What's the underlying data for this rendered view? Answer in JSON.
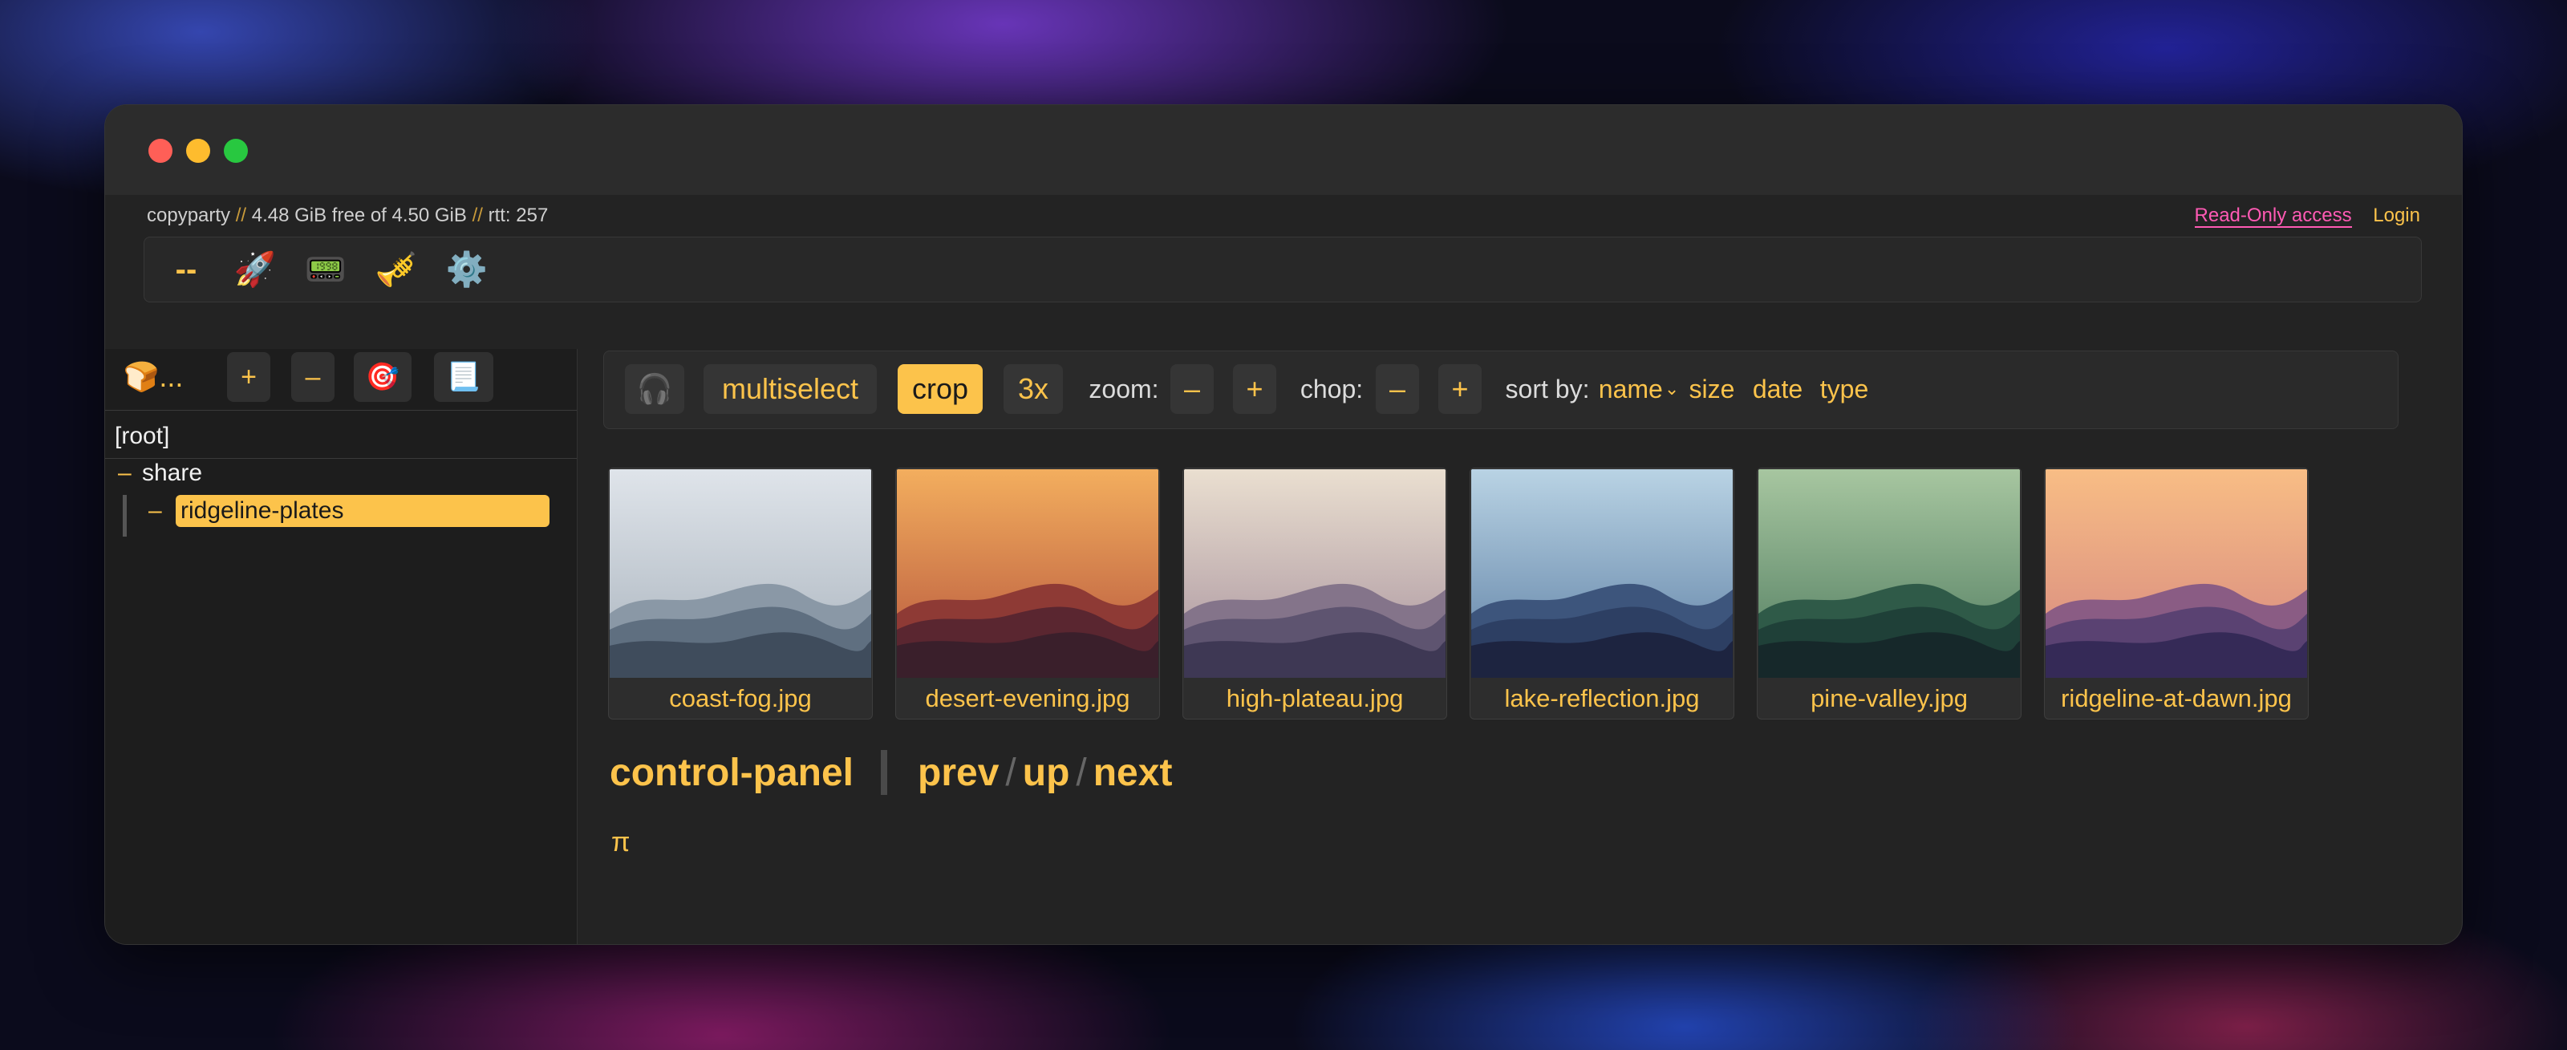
{
  "status": {
    "app": "copyparty",
    "sep": "//",
    "disk": "4.48 GiB free of 4.50 GiB",
    "rtt": "rtt: 257"
  },
  "auth": {
    "readonly": "Read-Only access",
    "login": "Login"
  },
  "opbar": {
    "dash": "--",
    "icons": [
      "rocket-icon",
      "pager-icon",
      "trumpet-icon",
      "gear-icon"
    ],
    "glyphs": [
      "🚀",
      "📟",
      "🎺",
      "⚙️"
    ]
  },
  "sidebar": {
    "bread_label": "🍞...",
    "plus": "+",
    "minus": "–",
    "target": "🎯",
    "scroll": "📃",
    "root": "[root]",
    "tree_minus": "–",
    "share": "share",
    "selected": "ridgeline-plates"
  },
  "controls": {
    "headphones": "🎧",
    "multiselect": "multiselect",
    "crop": "crop",
    "scale": "3x",
    "zoom_label": "zoom:",
    "chop_label": "chop:",
    "minus": "–",
    "plus": "+",
    "sort_label": "sort by:",
    "sort_name": "name",
    "sort_name_marker": "⌄",
    "sort_size": "size",
    "sort_date": "date",
    "sort_type": "type"
  },
  "files": [
    {
      "name": "coast-fog.jpg",
      "sky": [
        "#dfe4ea",
        "#a9b3bd"
      ],
      "hills": [
        "#8a98a6",
        "#5f6f80",
        "#3f4c5c"
      ]
    },
    {
      "name": "desert-evening.jpg",
      "sky": [
        "#f3ae5e",
        "#b4533c"
      ],
      "hills": [
        "#8e3a35",
        "#5a2630",
        "#3a1f2b"
      ]
    },
    {
      "name": "high-plateau.jpg",
      "sky": [
        "#eadfd0",
        "#a6909c"
      ],
      "hills": [
        "#84748a",
        "#5e5470",
        "#3e3854"
      ]
    },
    {
      "name": "lake-reflection.jpg",
      "sky": [
        "#b9d3e4",
        "#5c7ea3"
      ],
      "hills": [
        "#3d557c",
        "#2d3f63",
        "#1d2440"
      ]
    },
    {
      "name": "pine-valley.jpg",
      "sky": [
        "#a7c6a0",
        "#4e7a5e"
      ],
      "hills": [
        "#2f5a48",
        "#1f4038",
        "#16282a"
      ]
    },
    {
      "name": "ridgeline-at-dawn.jpg",
      "sky": [
        "#f8bd85",
        "#d48680"
      ],
      "hills": [
        "#8a5c84",
        "#5a4272",
        "#352a57"
      ]
    }
  ],
  "nav": {
    "control_panel": "control-panel",
    "prev": "prev",
    "up": "up",
    "next": "next",
    "slash": "/"
  },
  "pi": "π"
}
